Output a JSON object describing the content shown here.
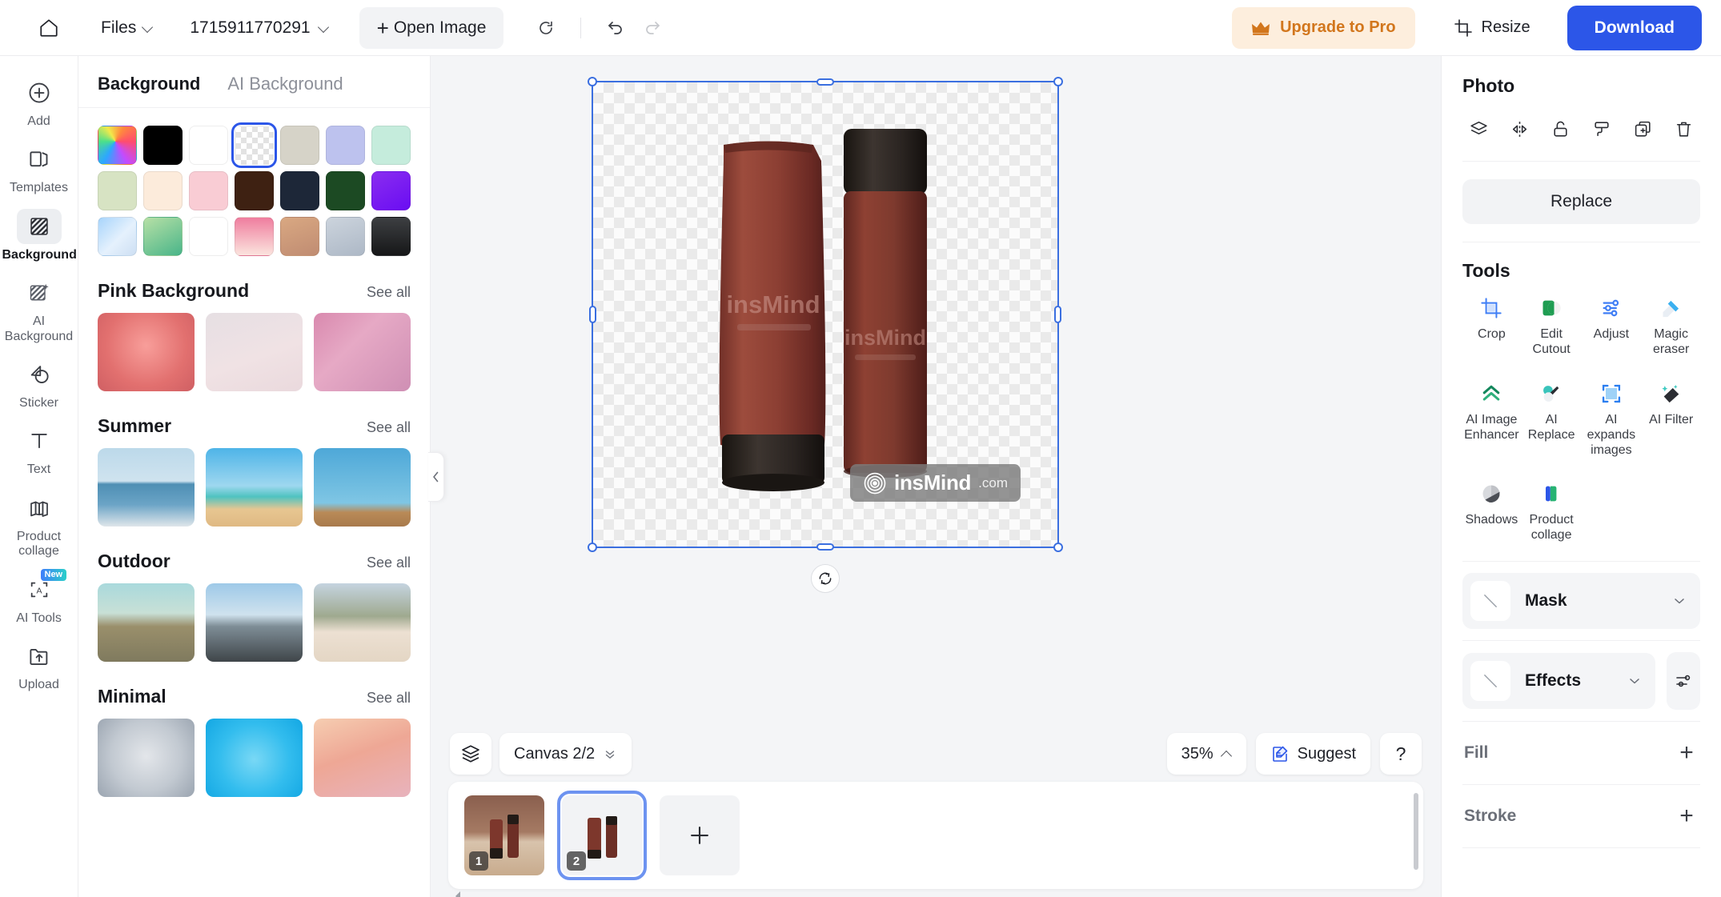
{
  "topbar": {
    "home_icon": "home-icon",
    "files_label": "Files",
    "doc_name": "1715911770291",
    "open_image_label": "Open Image",
    "refresh_icon": "refresh-icon",
    "undo_icon": "undo-icon",
    "redo_icon": "redo-icon",
    "upgrade_label": "Upgrade to Pro",
    "crown_icon": "crown-icon",
    "resize_label": "Resize",
    "download_label": "Download",
    "accent_blue": "#2c56e8",
    "upgrade_bg": "#fdeedd",
    "upgrade_fg": "#d2761c"
  },
  "rail": {
    "items": [
      {
        "label": "Add",
        "icon": "plus-circle-icon",
        "active": false,
        "badge": ""
      },
      {
        "label": "Templates",
        "icon": "templates-icon",
        "active": false,
        "badge": ""
      },
      {
        "label": "Background",
        "icon": "background-hatch-icon",
        "active": true,
        "badge": ""
      },
      {
        "label": "AI Background",
        "icon": "ai-background-icon",
        "active": false,
        "badge": ""
      },
      {
        "label": "Sticker",
        "icon": "sticker-icon",
        "active": false,
        "badge": ""
      },
      {
        "label": "Text",
        "icon": "text-icon",
        "active": false,
        "badge": ""
      },
      {
        "label": "Product collage",
        "icon": "product-collage-icon",
        "active": false,
        "badge": ""
      },
      {
        "label": "AI Tools",
        "icon": "ai-tools-icon",
        "active": false,
        "badge": "New"
      },
      {
        "label": "Upload",
        "icon": "upload-icon",
        "active": false,
        "badge": ""
      }
    ]
  },
  "bgpanel": {
    "tabs": [
      {
        "label": "Background",
        "active": true
      },
      {
        "label": "AI Background",
        "active": false
      }
    ],
    "swatches": [
      {
        "name": "rainbow-gradient",
        "selected": false,
        "css": "conic-gradient(from 210deg at 45% 40%, #2da7ff, #4be08a, #f2e94b, #ff8a3d, #ff4d6d, #c34bff, #2da7ff)"
      },
      {
        "name": "black",
        "selected": false,
        "css": "#000000"
      },
      {
        "name": "white",
        "selected": false,
        "css": "#ffffff"
      },
      {
        "name": "transparent",
        "selected": true,
        "css": "checker"
      },
      {
        "name": "beige",
        "selected": false,
        "css": "#d6d3c8"
      },
      {
        "name": "periwinkle",
        "selected": false,
        "css": "#bdc2ee"
      },
      {
        "name": "mint",
        "selected": false,
        "css": "#c5ecdc"
      },
      {
        "name": "sage",
        "selected": false,
        "css": "#d7e3c3"
      },
      {
        "name": "cream",
        "selected": false,
        "css": "#fcebdb"
      },
      {
        "name": "pink",
        "selected": false,
        "css": "#f9ccd4"
      },
      {
        "name": "dark-brown",
        "selected": false,
        "css": "#3e2112"
      },
      {
        "name": "navy",
        "selected": false,
        "css": "#1d2738"
      },
      {
        "name": "forest-green",
        "selected": false,
        "css": "#1c4a23"
      },
      {
        "name": "violet",
        "selected": false,
        "css": "linear-gradient(150deg,#8a2df0,#6a0df2)"
      },
      {
        "name": "blue-gradient",
        "selected": false,
        "css": "linear-gradient(135deg,#a7d4fb,#e5f1fd 55%,#cddff3)"
      },
      {
        "name": "green-gradient",
        "selected": false,
        "css": "linear-gradient(150deg,#b7e0a6,#49b589)"
      },
      {
        "name": "orange-gradient",
        "selected": false,
        "css": "linear-gradient(170deg,#fdc košm,#fb8b3a 55%,#f4603c)"
      },
      {
        "name": "pink-gradient",
        "selected": false,
        "css": "linear-gradient(180deg,#ef7d9e,#fbe4de)"
      },
      {
        "name": "tan-gradient",
        "selected": false,
        "css": "linear-gradient(160deg,#d9a882,#c08c72)"
      },
      {
        "name": "silver-gradient",
        "selected": false,
        "css": "linear-gradient(160deg,#ccd4dd,#adb8c6)"
      },
      {
        "name": "charcoal-gradient",
        "selected": false,
        "css": "linear-gradient(180deg,#3d3f42,#161718)"
      }
    ],
    "sections": [
      {
        "title": "Pink Background",
        "see_all": "See all",
        "thumbs": [
          {
            "name": "neon-heart-podium",
            "css": "radial-gradient(circle at 50% 42%, #f89e9a 0%, #e2706f 60%, #cf5f63 100%)"
          },
          {
            "name": "pink-flower-wall",
            "css": "linear-gradient(160deg, #e6dfe3 0%, #f0e2e4 55%, #ead9dd 100%)"
          },
          {
            "name": "pink-curtain-window",
            "css": "linear-gradient(135deg, #d989ae 0%, #e6a9c5 40%, #cf8fb4 100%)"
          }
        ]
      },
      {
        "title": "Summer",
        "see_all": "See all",
        "thumbs": [
          {
            "name": "calm-sea-horizon",
            "css": "linear-gradient(180deg, #bcd9ea 0%, #cfe3ef 42%, #4e8fb4 46%, #6ba4c6 72%, #dfe6ea 100%)"
          },
          {
            "name": "beach-sand-sky",
            "css": "linear-gradient(180deg, #4eb4e8 0%, #9ed7ef 48%, #4fc3c0 62%, #e7c691 78%, #dfb983 100%)"
          },
          {
            "name": "pool-water-deck",
            "css": "linear-gradient(180deg, #4ea8d8 0%, #7fc6e4 70%, #b98a57 82%, #a87a4c 100%)"
          }
        ]
      },
      {
        "title": "Outdoor",
        "see_all": "See all",
        "thumbs": [
          {
            "name": "desert-road",
            "css": "linear-gradient(180deg, #a9d9dc 0%, #c8e0d6 38%, #9a8f6b 55%, #7f7a5e 100%)"
          },
          {
            "name": "city-highway",
            "css": "linear-gradient(180deg, #9ec9e8 0%, #cfe2ee 40%, #7e8d96 55%, #3f4549 100%)"
          },
          {
            "name": "mountain-wood-table",
            "css": "linear-gradient(180deg, #c5d4e0 0%, #9fa98f 42%, #ece0d2 62%, #e4d6c4 100%)"
          }
        ]
      },
      {
        "title": "Minimal",
        "see_all": "See all",
        "thumbs": [
          {
            "name": "grey-radial",
            "css": "radial-gradient(circle at 50% 48%, #e3e6ea 0%, #c2c9d1 55%, #9aa4b0 100%)"
          },
          {
            "name": "cyan-radial",
            "css": "radial-gradient(circle at 50% 52%, #79d8f5 0%, #33bdee 55%, #13a7e3 100%)"
          },
          {
            "name": "peach-radial",
            "css": "linear-gradient(160deg, #f6cdb1 0%, #eea795 45%, #e8b3bd 100%)"
          }
        ]
      }
    ],
    "collapse_icon": "chevron-left-icon"
  },
  "canvas": {
    "layers_icon": "layers-icon",
    "canvas_label": "Canvas 2/2",
    "zoom_label": "35%",
    "suggest_label": "Suggest",
    "suggest_icon": "suggest-icon",
    "help_label": "?",
    "rotate_icon": "rotate-icon",
    "watermark": {
      "brand": "insMind",
      "suffix": ".com",
      "icon": "insmind-logo-icon"
    },
    "product_alt": "two insMind cosmetic containers: a squeeze tube and a bottle"
  },
  "filmstrip": {
    "items": [
      {
        "number": "1",
        "name": "page-thumbnail-1",
        "selected": false,
        "kind": "photo"
      },
      {
        "number": "2",
        "name": "page-thumbnail-2",
        "selected": true,
        "kind": "transparent"
      }
    ],
    "add_label": "+",
    "prev_icon": "chevron-left-icon"
  },
  "rightpanel": {
    "title": "Photo",
    "actions": [
      {
        "name": "layers-icon"
      },
      {
        "name": "flip-icon"
      },
      {
        "name": "unlock-icon"
      },
      {
        "name": "paint-roller-icon"
      },
      {
        "name": "duplicate-icon"
      },
      {
        "name": "delete-icon"
      }
    ],
    "replace_label": "Replace",
    "tools_title": "Tools",
    "tools": [
      {
        "label": "Crop",
        "icon": "crop-icon"
      },
      {
        "label": "Edit Cutout",
        "icon": "edit-cutout-icon"
      },
      {
        "label": "Adjust",
        "icon": "adjust-icon"
      },
      {
        "label": "Magic eraser",
        "icon": "magic-eraser-icon"
      },
      {
        "label": "AI Image Enhancer",
        "icon": "ai-image-enhancer-icon"
      },
      {
        "label": "AI Replace",
        "icon": "ai-replace-icon"
      },
      {
        "label": "AI expands images",
        "icon": "ai-expands-images-icon"
      },
      {
        "label": "AI Filter",
        "icon": "ai-filter-icon"
      },
      {
        "label": "Shadows",
        "icon": "shadows-icon"
      },
      {
        "label": "Product collage",
        "icon": "product-collage-icon"
      }
    ],
    "mask_label": "Mask",
    "effects_label": "Effects",
    "fill_label": "Fill",
    "stroke_label": "Stroke",
    "add_symbol": "+"
  }
}
